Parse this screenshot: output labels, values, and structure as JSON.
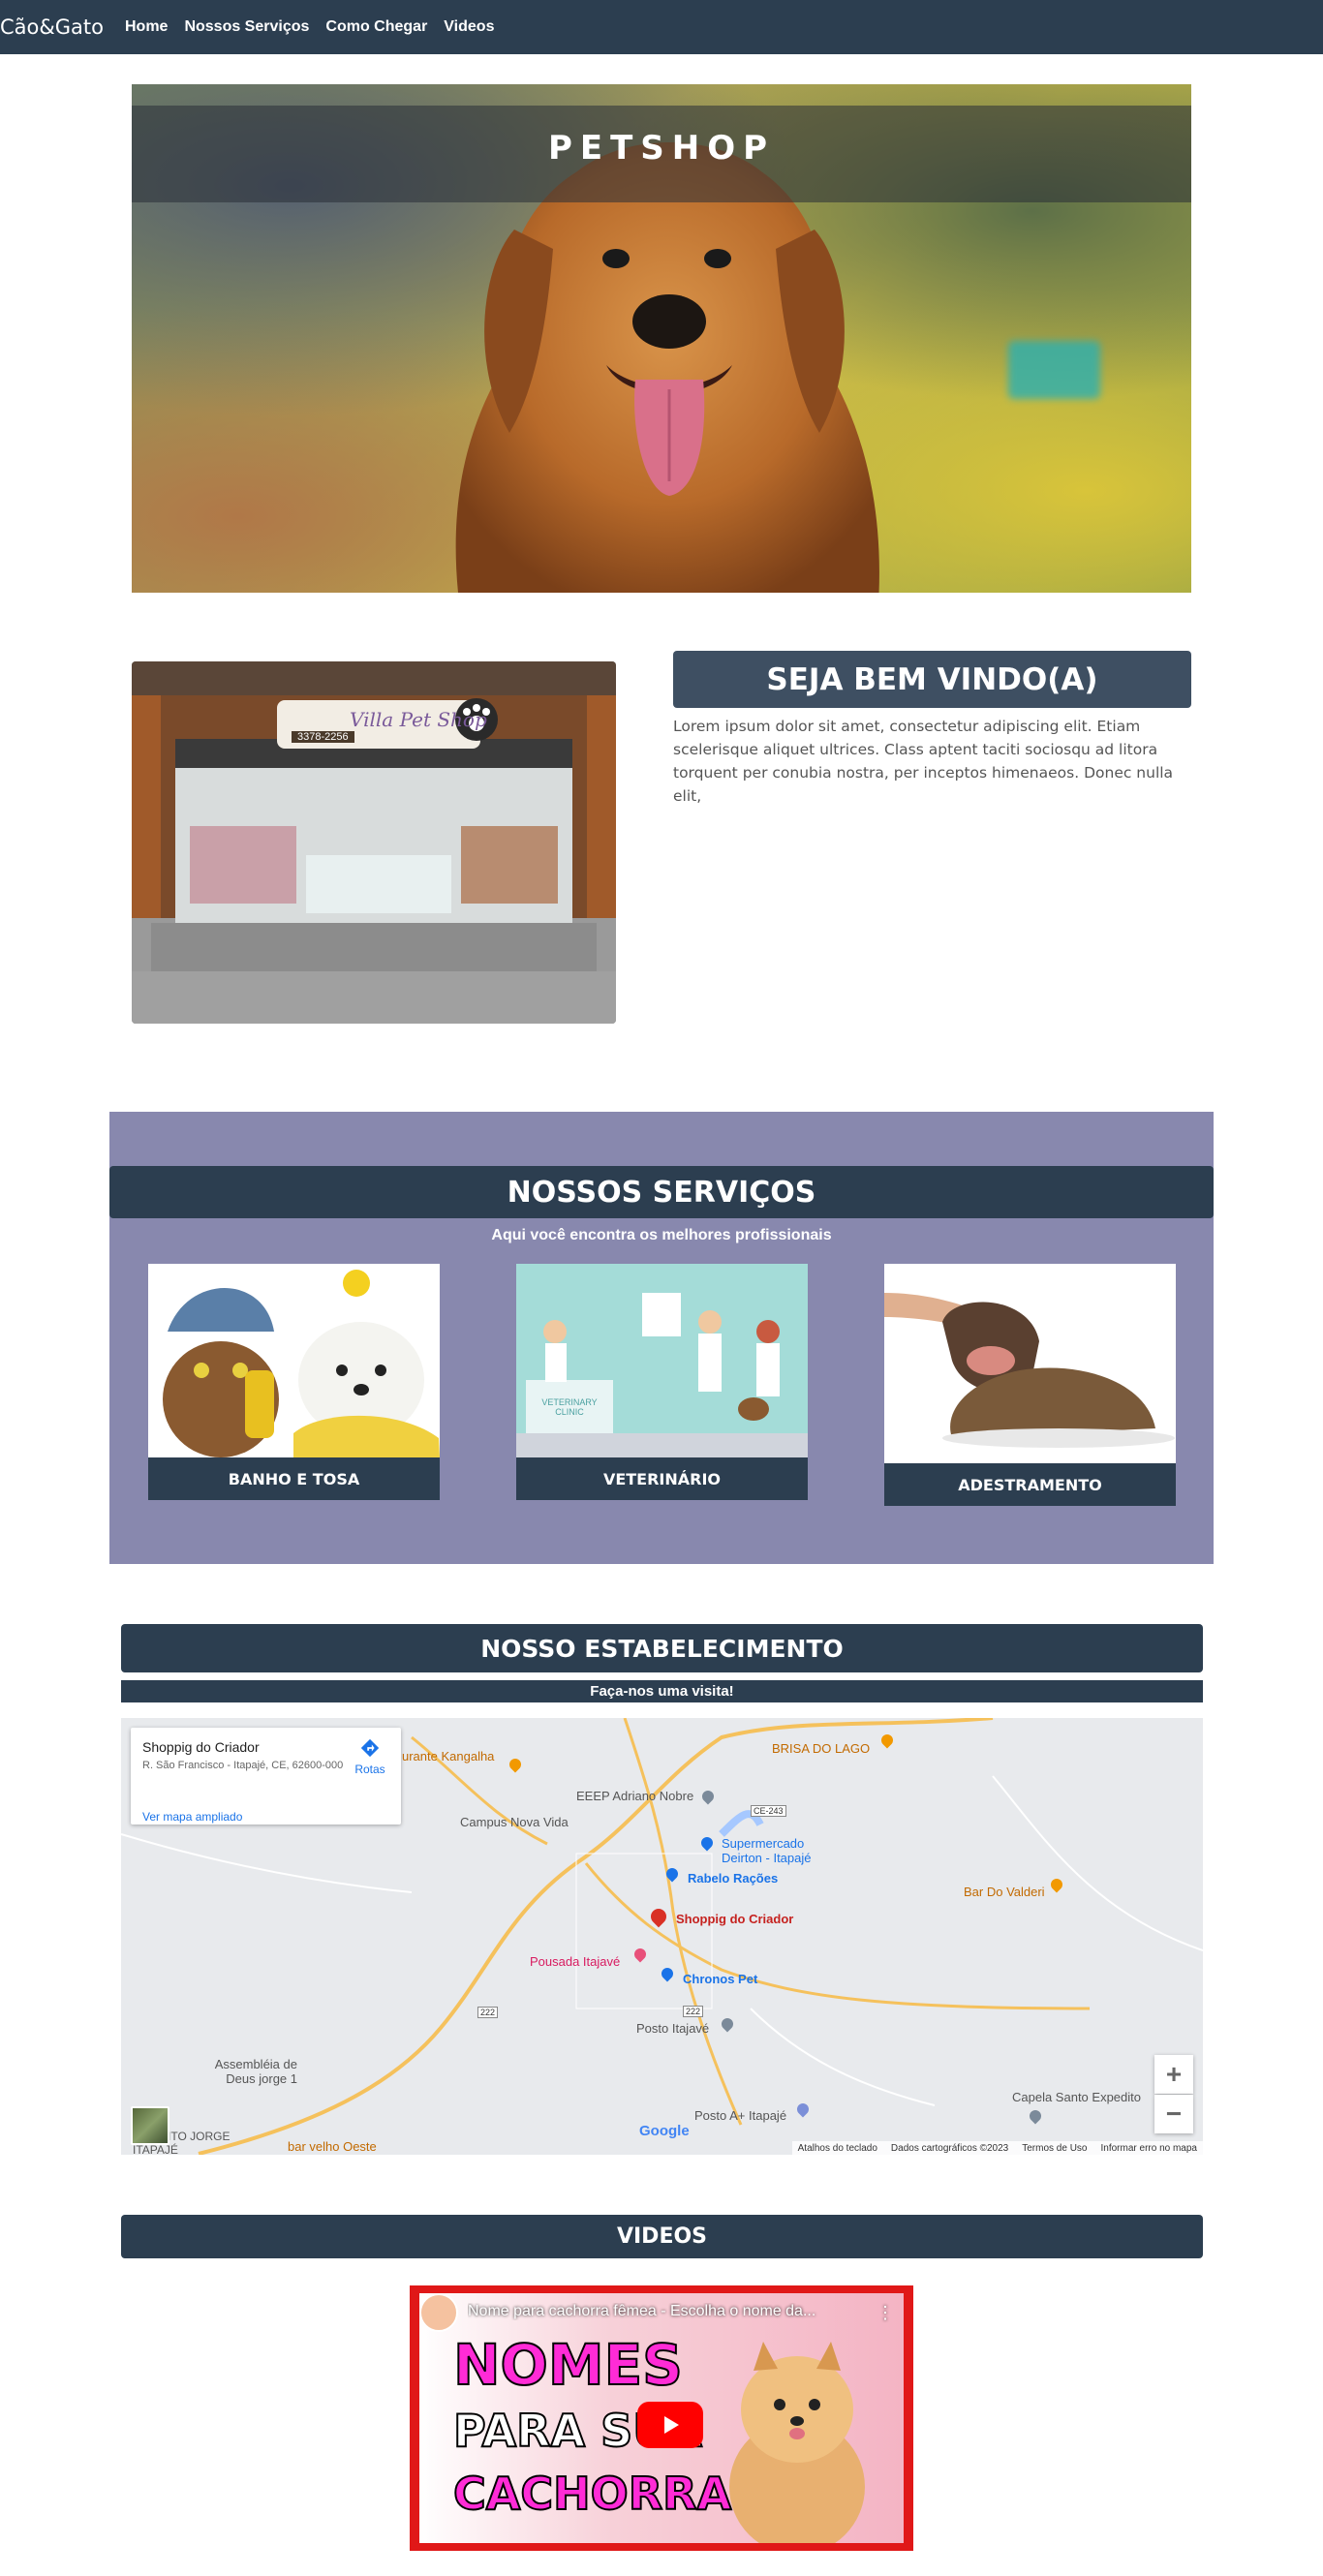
{
  "navbar": {
    "brand": "Cão&Gato",
    "links": [
      "Home",
      "Nossos Serviços",
      "Como Chegar",
      "Videos"
    ]
  },
  "hero": {
    "title": "PETSHOP"
  },
  "welcome": {
    "title": "SEJA BEM VINDO(A)",
    "text": "Lorem ipsum dolor sit amet, consectetur adipiscing elit. Etiam scelerisque aliquet ultrices. Class aptent taciti sociosqu ad litora torquent per conubia nostra, per inceptos himenaeos. Donec nulla elit,",
    "shop_sign": "Villa Pet Shop",
    "shop_phone": "3378-2256"
  },
  "services": {
    "title": "NOSSOS SERVIÇOS",
    "subtitle": "Aqui você encontra os melhores profissionais",
    "cards": [
      {
        "label": "BANHO E TOSA"
      },
      {
        "label": "VETERINÁRIO",
        "img_text": "VETERINARY CLINIC"
      },
      {
        "label": "ADESTRAMENTO"
      }
    ]
  },
  "establishment": {
    "title": "NOSSO ESTABELECIMENTO",
    "subtitle": "Faça-nos uma visita!",
    "map": {
      "place_name": "Shoppig do Criador",
      "address": "R. São Francisco - Itapajé, CE, 62600-000",
      "bigger_map_link": "Ver mapa ampliado",
      "directions": "Rotas",
      "labels": [
        "urante Kangalha",
        "BRISA DO LAGO",
        "EEEP Adriano Nobre",
        "Campus Nova Vida",
        "Supermercado Deirton - Itapajé",
        "Rabelo Rações",
        "Bar Do Valderi",
        "Shoppig do Criador",
        "Pousada Itajavé",
        "Chronos Pet",
        "Posto Itajavé",
        "Assembléia de Deus jorge 1",
        "DISTRITO JORGE ITAPAJÉ",
        "bar velho Oeste",
        "Posto A+ Itapajé",
        "Capela Santo Expedito"
      ],
      "road_labels": [
        "CE-243",
        "222",
        "222"
      ],
      "zoom_in": "+",
      "zoom_out": "−",
      "footer": [
        "Atalhos do teclado",
        "Dados cartográficos ©2023",
        "Termos de Uso",
        "Informar erro no mapa"
      ],
      "logo": "Google"
    }
  },
  "videos": {
    "title": "VIDEOS",
    "video_title": "Nome para cachorra fêmea - Escolha o nome da...",
    "thumb_lines": [
      "NOMES",
      "PARA SUA",
      "CACHORRA"
    ]
  }
}
